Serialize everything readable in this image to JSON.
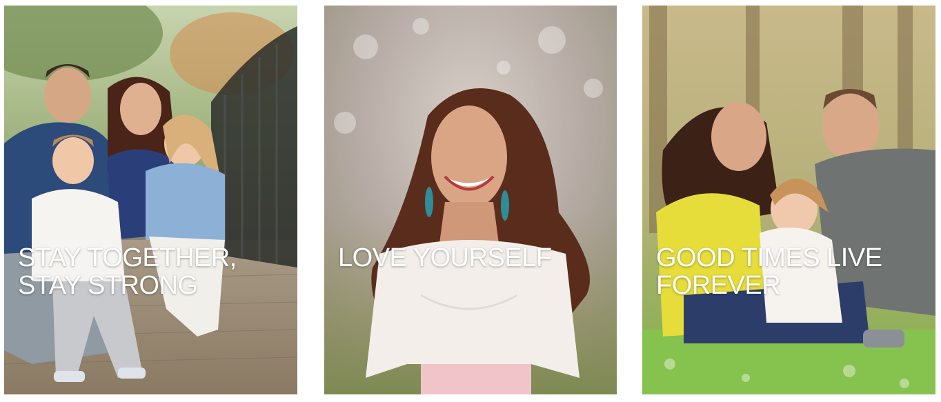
{
  "gallery": {
    "tiles": [
      {
        "image": "family-of-four-on-bridge-photo",
        "caption_lines": [
          "STAY TOGETHER,",
          "STAY STRONG"
        ]
      },
      {
        "image": "smiling-woman-in-lace-top-photo",
        "caption_lines": [
          "LOVE YOURSELF"
        ]
      },
      {
        "image": "family-of-three-on-grass-photo",
        "caption_lines": [
          "GOOD TIMES LIVE",
          "FOREVER"
        ]
      }
    ]
  },
  "colors": {
    "caption_text": "#ffffff",
    "page_background": "#ffffff"
  }
}
